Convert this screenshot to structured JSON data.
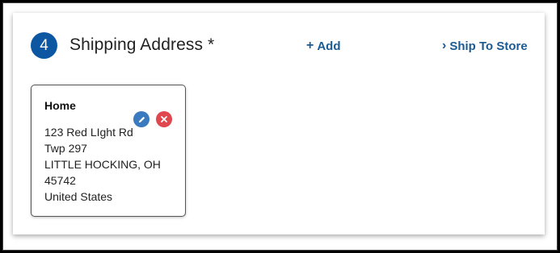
{
  "section": {
    "step_number": "4",
    "title": "Shipping Address *",
    "add_label": "Add",
    "ship_to_store_label": "Ship To Store"
  },
  "addresses": [
    {
      "name": "Home",
      "lines": [
        "123 Red LIght Rd",
        "Twp 297",
        "LITTLE HOCKING, OH",
        "45742",
        "United States"
      ]
    }
  ],
  "colors": {
    "accent": "#0d57a2",
    "link": "#1c5a92",
    "edit": "#3a7bbf",
    "delete": "#e0474f"
  },
  "icons": {
    "add": "plus-icon",
    "ship_to_store": "chevron-right-icon",
    "edit": "pencil-icon",
    "delete": "close-icon"
  }
}
